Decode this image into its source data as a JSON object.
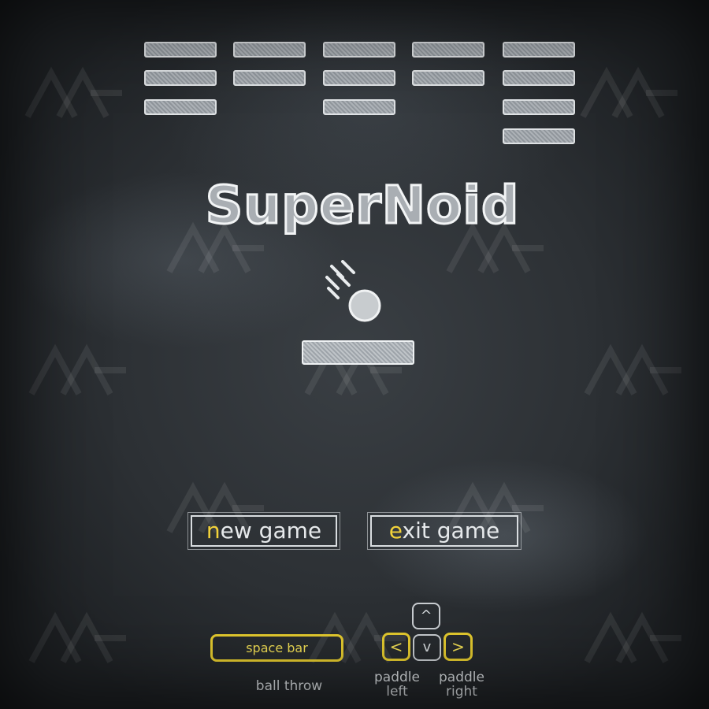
{
  "game": {
    "title": "SuperNoid"
  },
  "menu": {
    "new_game": {
      "hotkey": "n",
      "rest": "ew game"
    },
    "exit_game": {
      "hotkey": "e",
      "rest": "xit game"
    }
  },
  "controls": {
    "space_key": "space bar",
    "space_caption": "ball  throw",
    "up_key": "^",
    "down_key": "v",
    "left_key": "<",
    "right_key": ">",
    "left_caption_1": "paddle",
    "left_caption_2": "left",
    "right_caption_1": "paddle",
    "right_caption_2": "right"
  },
  "colors": {
    "chalkboard": "#2b2f33",
    "chalk": "#eef1f3",
    "highlight": "#f2d23a"
  },
  "icons": {
    "ball": "chalk-ball-icon",
    "motion": "motion-lines-icon",
    "watermark": "logo-watermark-icon"
  }
}
